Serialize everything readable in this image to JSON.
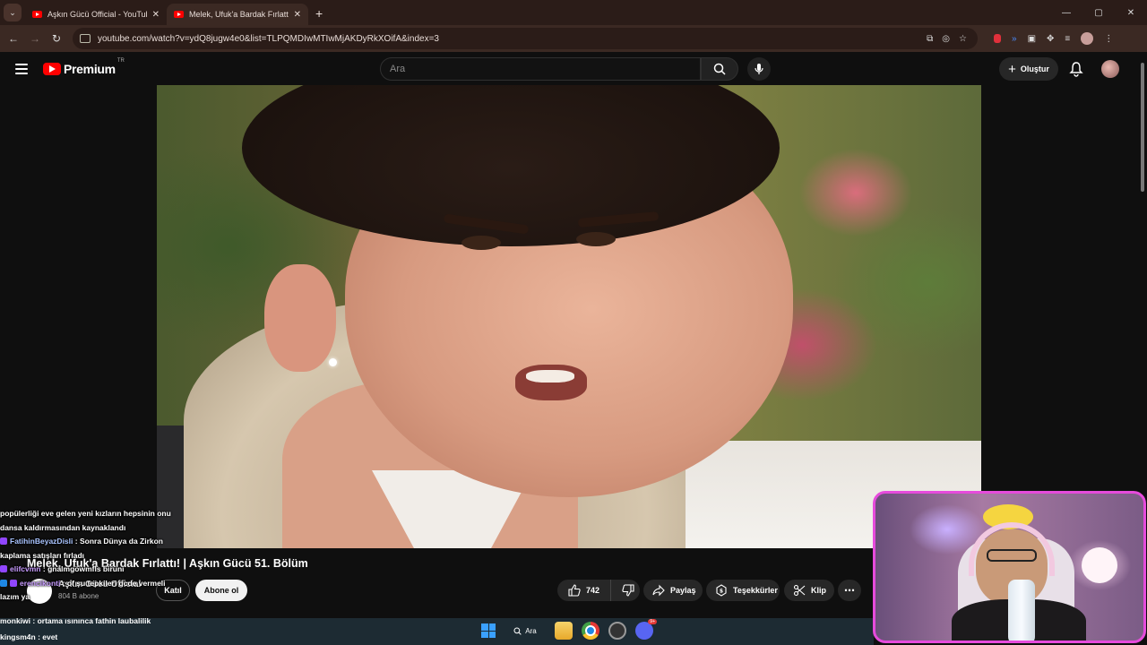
{
  "browser": {
    "tabs": [
      {
        "title": "Aşkın Gücü Official - YouTube",
        "active": false
      },
      {
        "title": "Melek, Ufuk'a Bardak Fırlattı! | A",
        "active": true
      }
    ],
    "url": "youtube.com/watch?v=ydQ8jugw4e0&list=TLPQMDIwMTIwMjAKDyRkXOifA&index=3",
    "window_controls": {
      "minimize": "—",
      "maximize": "▢",
      "close": "✕"
    }
  },
  "youtube": {
    "logo_text": "Premium",
    "country_code": "TR",
    "search_placeholder": "Ara",
    "create_label": "Oluştur"
  },
  "video": {
    "title": "Melek, Ufuk'a Bardak Fırlattı! | Aşkın Gücü 51. Bölüm",
    "channel_name": "Aşkın Gücü Official",
    "subscribers": "804 B abone",
    "join_label": "Katıl",
    "subscribe_label": "Abone ol",
    "likes": "742",
    "share_label": "Paylaş",
    "thanks_label": "Teşekkürler",
    "clip_label": "Klip",
    "more_label": "⋯"
  },
  "chat": {
    "lines": [
      {
        "text": "popülerliği eve gelen yeni kızların hepsinin onu"
      },
      {
        "text": "dansa kaldırmasından kaynaklandı"
      },
      {
        "user": "FatihinBeyazDisli",
        "text": ": Sonra Dünya da Zirkon"
      },
      {
        "text": "kaplama satışları fırladı"
      },
      {
        "user": "elifcvmn",
        "text": ": gnalmgöwmfls biruni"
      },
      {
        "user": "erencikonti",
        "text": ": of şu tepkileri gcde vermeli"
      },
      {
        "text": "lazım ya"
      }
    ],
    "lower_lines": [
      {
        "user": "monkiwi",
        "text": ": ortama ısınınca fathin laubalilik"
      },
      {
        "user": "kingsm4n",
        "text": ": evet"
      }
    ]
  },
  "taskbar": {
    "search_label": "Ara",
    "discord_badge": "9+"
  },
  "colors": {
    "youtube_red": "#ff0000",
    "webcam_border": "#e64bdc",
    "chrome_frame": "#2b1c18"
  }
}
